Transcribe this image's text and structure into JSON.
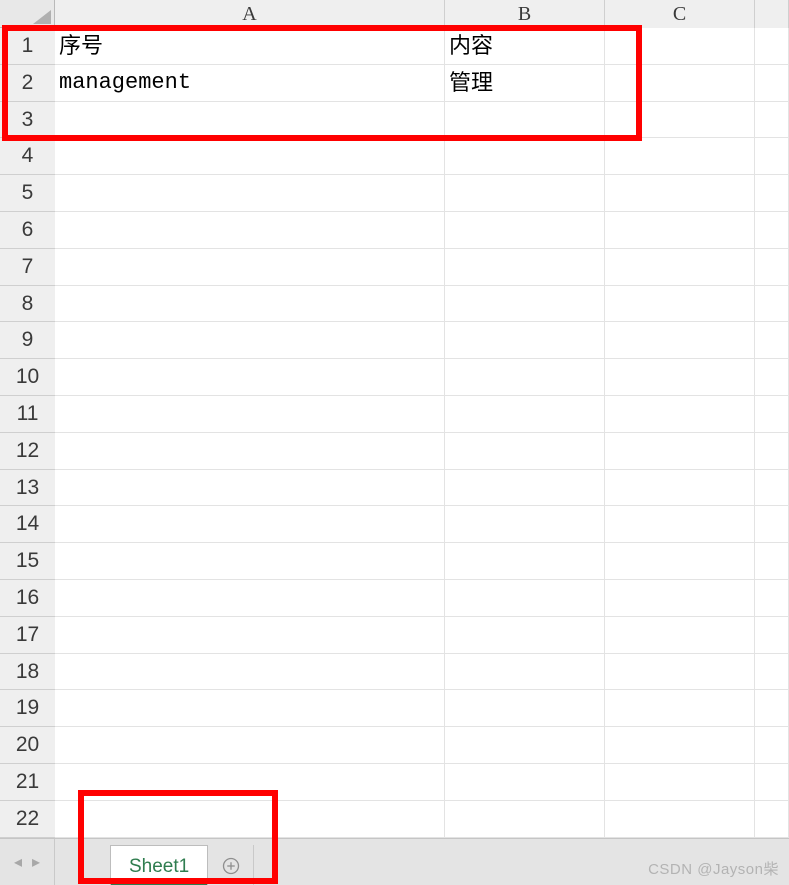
{
  "columns": [
    "A",
    "B",
    "C"
  ],
  "rows": [
    1,
    2,
    3,
    4,
    5,
    6,
    7,
    8,
    9,
    10,
    11,
    12,
    13,
    14,
    15,
    16,
    17,
    18,
    19,
    20,
    21,
    22
  ],
  "cells": {
    "r1": {
      "A": "序号",
      "B": "内容"
    },
    "r2": {
      "A": "management",
      "B": "管理"
    }
  },
  "tabs": {
    "active": "Sheet1"
  },
  "nav": {
    "prev": "◂",
    "next": "▸"
  },
  "watermark": "CSDN @Jayson柴"
}
